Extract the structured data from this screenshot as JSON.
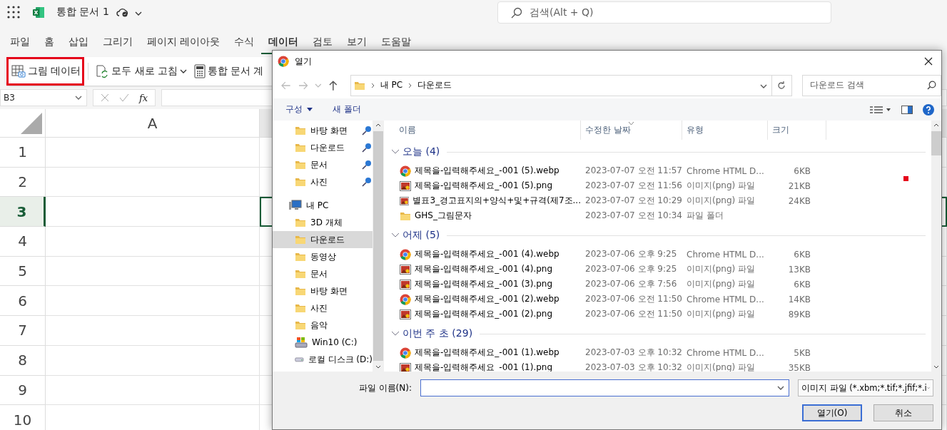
{
  "excel": {
    "title": "통합 문서 1",
    "search": {
      "placeholder": "검색(Alt + Q)"
    },
    "ribbon": {
      "tabs": [
        {
          "label": "파일",
          "selected": false
        },
        {
          "label": "홈",
          "selected": false
        },
        {
          "label": "삽입",
          "selected": false
        },
        {
          "label": "그리기",
          "selected": false
        },
        {
          "label": "페이지 레이아웃",
          "selected": false
        },
        {
          "label": "수식",
          "selected": false
        },
        {
          "label": "데이터",
          "selected": true
        },
        {
          "label": "검토",
          "selected": false
        },
        {
          "label": "보기",
          "selected": false
        },
        {
          "label": "도움말",
          "selected": false
        }
      ],
      "commands": [
        {
          "kind": "picture-data",
          "label": "그림 데이터",
          "highlighted": true
        },
        {
          "kind": "refresh",
          "label": "모두 새로 고침",
          "highlighted": false
        },
        {
          "kind": "calc",
          "label": "통합 문서 계",
          "highlighted": false
        }
      ]
    },
    "name_box": "B3",
    "fx": "fx",
    "columns": [
      "A"
    ],
    "rows": [
      {
        "label": "1",
        "selected": false
      },
      {
        "label": "2",
        "selected": false
      },
      {
        "label": "3",
        "selected": true
      },
      {
        "label": "4",
        "selected": false
      },
      {
        "label": "5",
        "selected": false
      },
      {
        "label": "6",
        "selected": false
      },
      {
        "label": "7",
        "selected": false
      },
      {
        "label": "8",
        "selected": false
      },
      {
        "label": "9",
        "selected": false
      },
      {
        "label": "10",
        "selected": false
      }
    ]
  },
  "dialog": {
    "title": "열기",
    "breadcrumb": [
      "내 PC",
      "다운로드"
    ],
    "search": {
      "placeholder": "다운로드 검색"
    },
    "toolbar": {
      "organize": "구성",
      "new_folder": "새 폴더"
    },
    "nav": [
      {
        "label": "바탕 화면",
        "kind": "folder",
        "pinned": true,
        "selected": false
      },
      {
        "label": "다운로드",
        "kind": "folder",
        "pinned": true,
        "selected": false
      },
      {
        "label": "문서",
        "kind": "folder",
        "pinned": true,
        "selected": false
      },
      {
        "label": "사진",
        "kind": "folder",
        "pinned": true,
        "selected": false
      },
      {
        "label": "내 PC",
        "kind": "computer",
        "pinned": false,
        "selected": false,
        "children": [
          {
            "label": "3D 개체",
            "kind": "folder",
            "pinned": false,
            "selected": false
          },
          {
            "label": "다운로드",
            "kind": "folder",
            "pinned": false,
            "selected": true
          },
          {
            "label": "동영상",
            "kind": "folder",
            "pinned": false,
            "selected": false
          },
          {
            "label": "문서",
            "kind": "folder",
            "pinned": false,
            "selected": false
          },
          {
            "label": "바탕 화면",
            "kind": "folder",
            "pinned": false,
            "selected": false
          },
          {
            "label": "사진",
            "kind": "folder",
            "pinned": false,
            "selected": false
          },
          {
            "label": "음악",
            "kind": "folder",
            "pinned": false,
            "selected": false
          },
          {
            "label": "Win10 (C:)",
            "kind": "system-drive",
            "pinned": false,
            "selected": false
          },
          {
            "label": "로컬 디스크 (D:)",
            "kind": "drive",
            "pinned": false,
            "selected": false
          }
        ]
      }
    ],
    "columns": [
      "이름",
      "수정한 날짜",
      "유형",
      "크기"
    ],
    "groups": [
      {
        "label": "오늘 (4)",
        "expanded": true,
        "files": [
          {
            "name": "제목을-입력해주세요_-001 (5).webp",
            "kind": "chrome",
            "date": "2023-07-07 오전 11:57",
            "type": "Chrome HTML D...",
            "size": "6KB"
          },
          {
            "name": "제목을-입력해주세요_-001 (5).png",
            "kind": "image",
            "date": "2023-07-07 오전 11:56",
            "type": "이미지(png) 파일",
            "size": "21KB"
          },
          {
            "name": "별표3_경고표지의+양식+및+규격(제7조...",
            "kind": "image",
            "date": "2023-07-07 오전 10:29",
            "type": "이미지(png) 파일",
            "size": "24KB"
          },
          {
            "name": "GHS_그림문자",
            "kind": "folder",
            "date": "2023-07-07 오전 10:34",
            "type": "파일 폴더"
          }
        ]
      },
      {
        "label": "어제 (5)",
        "expanded": true,
        "files": [
          {
            "name": "제목을-입력해주세요_-001 (4).webp",
            "kind": "chrome",
            "date": "2023-07-06 오후 9:25",
            "type": "Chrome HTML D...",
            "size": "6KB"
          },
          {
            "name": "제목을-입력해주세요_-001 (4).png",
            "kind": "image",
            "date": "2023-07-06 오후 9:25",
            "type": "이미지(png) 파일",
            "size": "13KB"
          },
          {
            "name": "제목을-입력해주세요_-001 (3).png",
            "kind": "image",
            "date": "2023-07-06 오후 7:56",
            "type": "이미지(png) 파일",
            "size": "6KB"
          },
          {
            "name": "제목을-입력해주세요_-001 (2).webp",
            "kind": "chrome",
            "date": "2023-07-06 오전 11:50",
            "type": "Chrome HTML D...",
            "size": "14KB"
          },
          {
            "name": "제목을-입력해주세요_-001 (2).png",
            "kind": "image",
            "date": "2023-07-06 오전 11:50",
            "type": "이미지(png) 파일",
            "size": "89KB"
          }
        ]
      },
      {
        "label": "이번 주 초 (29)",
        "expanded": true,
        "files": [
          {
            "name": "제목을-입력해주세요_-001 (1).webp",
            "kind": "chrome",
            "date": "2023-07-03 오후 10:32",
            "type": "Chrome HTML D...",
            "size": "5KB"
          },
          {
            "name": "제목을-입력해주세요_-001 (1).png",
            "kind": "image",
            "date": "2023-07-03 오후 10:32",
            "type": "이미지(png) 파일",
            "size": "35KB"
          }
        ]
      }
    ],
    "file_name_label": "파일 이름(N):",
    "file_type": "이미지 파일 (*.xbm;*.tif;*.jfif;*.i",
    "buttons": [
      {
        "label": "열기(O)",
        "default": true
      },
      {
        "label": "취소",
        "default": false
      }
    ]
  }
}
